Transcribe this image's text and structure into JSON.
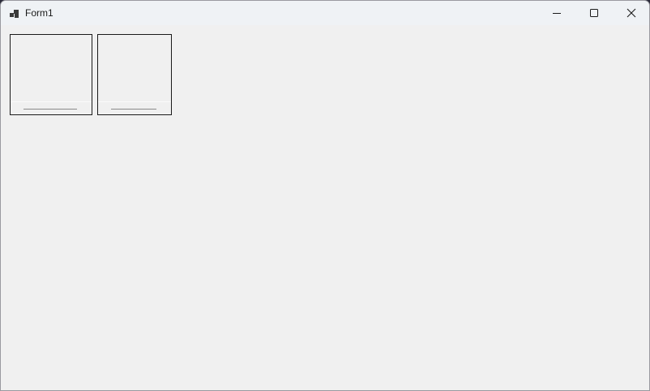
{
  "window": {
    "title": "Form1",
    "app_icon": "winforms-app-icon",
    "controls": {
      "minimize_icon": "minimize-icon",
      "maximize_icon": "maximize-icon",
      "close_icon": "close-icon"
    }
  },
  "colors": {
    "titlebar_bg": "#eff2f5",
    "client_bg": "#f0f0f0",
    "card_border": "#1a1a1a"
  },
  "cards": [
    {
      "label": ""
    },
    {
      "label": ""
    }
  ]
}
